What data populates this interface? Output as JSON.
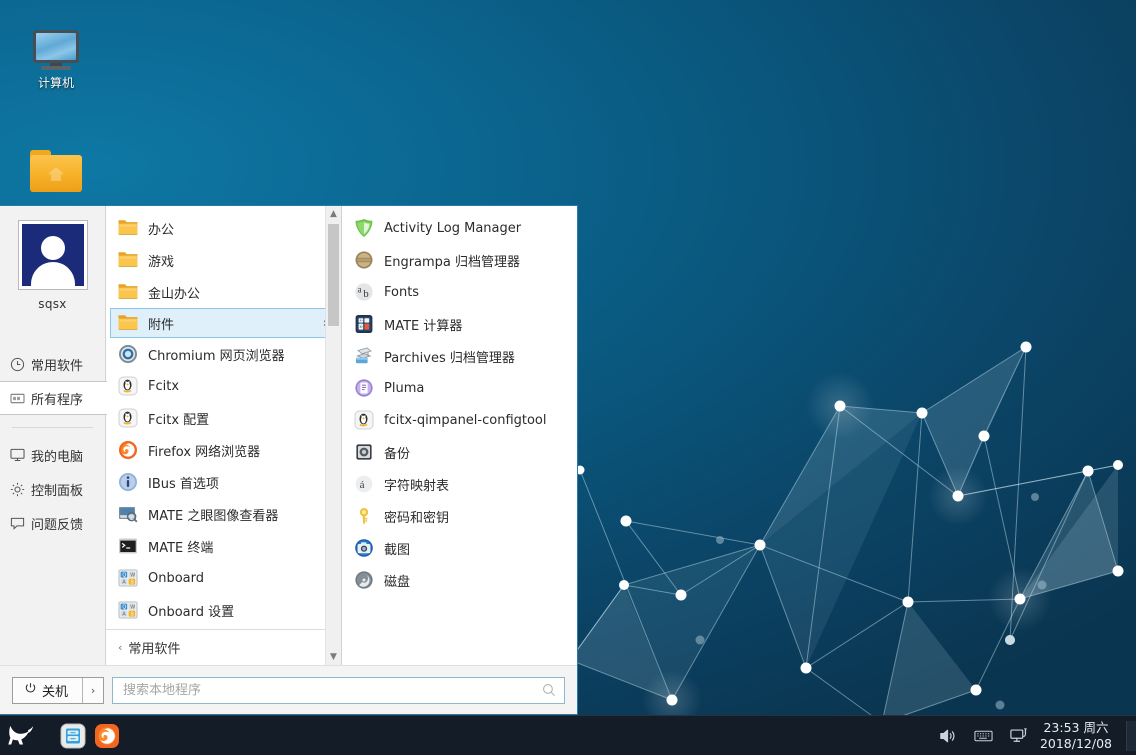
{
  "desktop": {
    "icons": [
      {
        "name": "computer",
        "label": "计算机",
        "icon": "monitor-icon"
      },
      {
        "name": "home-folder",
        "label": "",
        "icon": "home-folder-icon"
      }
    ]
  },
  "start_menu": {
    "user": {
      "name": "sqsx",
      "avatar": "user-avatar",
      "avatar_bg": "#1b2b7a"
    },
    "sidebar": [
      {
        "label": "常用软件",
        "icon": "clock-icon",
        "active": false
      },
      {
        "label": "所有程序",
        "icon": "apps-icon",
        "active": true
      },
      {
        "label": "我的电脑",
        "icon": "monitor-icon",
        "active": false
      },
      {
        "label": "控制面板",
        "icon": "gear-icon",
        "active": false
      },
      {
        "label": "问题反馈",
        "icon": "feedback-icon",
        "active": false
      }
    ],
    "app_list": [
      {
        "label": "办公",
        "icon": "folder-icon",
        "type": "folder",
        "selected": false,
        "has_submenu": true
      },
      {
        "label": "游戏",
        "icon": "folder-icon",
        "type": "folder",
        "selected": false,
        "has_submenu": true
      },
      {
        "label": "金山办公",
        "icon": "folder-icon",
        "type": "folder",
        "selected": false,
        "has_submenu": true
      },
      {
        "label": "附件",
        "icon": "folder-icon",
        "type": "folder",
        "selected": true,
        "has_submenu": true
      },
      {
        "label": "Chromium 网页浏览器",
        "icon": "chromium-icon",
        "type": "app",
        "selected": false,
        "has_submenu": false
      },
      {
        "label": "Fcitx",
        "icon": "fcitx-icon",
        "type": "app",
        "selected": false,
        "has_submenu": false
      },
      {
        "label": "Fcitx 配置",
        "icon": "fcitx-icon",
        "type": "app",
        "selected": false,
        "has_submenu": false
      },
      {
        "label": "Firefox 网络浏览器",
        "icon": "firefox-icon",
        "type": "app",
        "selected": false,
        "has_submenu": false
      },
      {
        "label": "IBus 首选项",
        "icon": "ibus-icon",
        "type": "app",
        "selected": false,
        "has_submenu": false
      },
      {
        "label": "MATE 之眼图像查看器",
        "icon": "eye-of-mate-icon",
        "type": "app",
        "selected": false,
        "has_submenu": false
      },
      {
        "label": "MATE 终端",
        "icon": "terminal-icon",
        "type": "app",
        "selected": false,
        "has_submenu": false
      },
      {
        "label": "Onboard",
        "icon": "onboard-icon",
        "type": "app",
        "selected": false,
        "has_submenu": false
      },
      {
        "label": "Onboard 设置",
        "icon": "onboard-icon",
        "type": "app",
        "selected": false,
        "has_submenu": false
      }
    ],
    "app_list_footer": {
      "label": "常用软件",
      "icon": "caret-left-icon"
    },
    "submenu": [
      {
        "label": "Activity Log Manager",
        "icon": "shield-icon"
      },
      {
        "label": "Engrampa 归档管理器",
        "icon": "engrampa-icon"
      },
      {
        "label": "Fonts",
        "icon": "fonts-icon"
      },
      {
        "label": "MATE 计算器",
        "icon": "calculator-icon"
      },
      {
        "label": "Parchives 归档管理器",
        "icon": "parchives-icon"
      },
      {
        "label": "Pluma",
        "icon": "pluma-icon"
      },
      {
        "label": "fcitx-qimpanel-configtool",
        "icon": "fcitx-icon"
      },
      {
        "label": "备份",
        "icon": "backup-icon"
      },
      {
        "label": "字符映射表",
        "icon": "charmap-icon"
      },
      {
        "label": "密码和密钥",
        "icon": "key-icon"
      },
      {
        "label": "截图",
        "icon": "screenshot-icon"
      },
      {
        "label": "磁盘",
        "icon": "disks-icon"
      }
    ],
    "bottom": {
      "shutdown_label": "关机",
      "shutdown_icon": "power-icon",
      "shutdown_more_icon": "chevron-right-icon",
      "search_placeholder": "搜索本地程序",
      "search_value": "",
      "search_icon": "search-icon"
    },
    "accent_color": "#2a7aa8",
    "selection_bg": "#dff0fb",
    "selection_border": "#8cc6e8"
  },
  "taskbar": {
    "menu_button_icon": "cat-logo-icon",
    "pinned": [
      {
        "name": "file-manager",
        "icon": "file-manager-icon"
      },
      {
        "name": "firefox",
        "icon": "firefox-icon"
      }
    ],
    "tray": [
      {
        "name": "volume",
        "icon": "volume-icon"
      },
      {
        "name": "keyboard",
        "icon": "keyboard-icon"
      },
      {
        "name": "network",
        "icon": "network-icon"
      }
    ],
    "clock": {
      "time": "23:53 周六",
      "date": "2018/12/08"
    },
    "background": "#131c27"
  }
}
